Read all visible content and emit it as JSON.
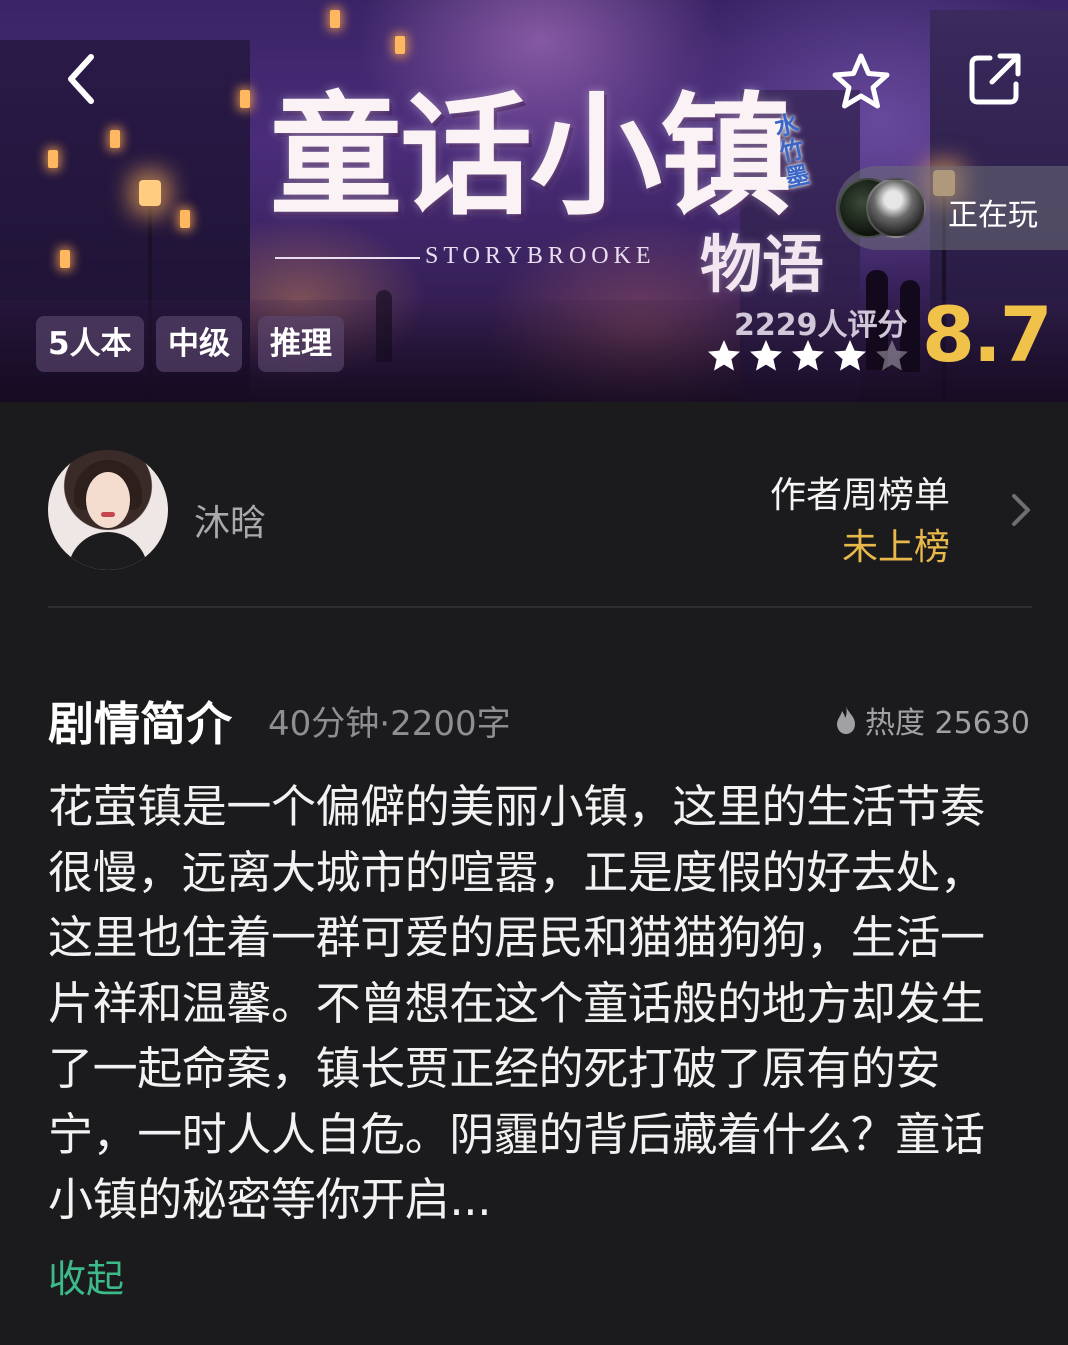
{
  "hero": {
    "title_main": "童话小镇",
    "title_sub": "物语",
    "title_en": "STORYBROOKE",
    "seal_text": "水竹墨",
    "back_icon": "chevron-left-icon",
    "favorite_icon": "star-outline-icon",
    "share_icon": "share-icon",
    "playing_label": "正在玩",
    "tags": [
      "5人本",
      "中级",
      "推理"
    ],
    "rating_count": "2229人评分",
    "score": "8.7",
    "stars_filled": 4,
    "stars_total": 5
  },
  "author": {
    "name": "沐晗",
    "rank_title": "作者周榜单",
    "rank_value": "未上榜",
    "chevron_icon": "chevron-right-icon"
  },
  "synopsis": {
    "title": "剧情简介",
    "meta": "40分钟·2200字",
    "heat_icon": "flame-icon",
    "heat": "热度 25630",
    "body": "花萤镇是一个偏僻的美丽小镇，这里的生活节奏很慢，远离大城市的喧嚣，正是度假的好去处，这里也住着一群可爱的居民和猫猫狗狗，生活一片祥和温馨。不曾想在这个童话般的地方却发生了一起命案，镇长贾正经的死打破了原有的安宁，一时人人自危。阴霾的背后藏着什么？童话小镇的秘密等你开启...",
    "collapse_label": "收起"
  },
  "colors": {
    "background": "#1b1b1d",
    "score": "#f0c24a",
    "rank_value": "#e8b84a",
    "collapse": "#3dba8a"
  }
}
